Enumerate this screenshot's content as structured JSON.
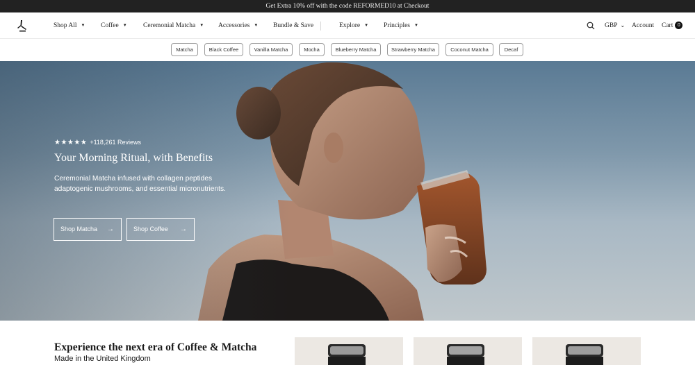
{
  "announcement": "Get Extra 10% off with the code REFORMED10 at Checkout",
  "nav": {
    "items": [
      {
        "label": "Shop All",
        "caret": true
      },
      {
        "label": "Coffee",
        "caret": true
      },
      {
        "label": "Ceremonial Matcha",
        "caret": true
      },
      {
        "label": "Accessories",
        "caret": true
      },
      {
        "label": "Bundle & Save",
        "caret": false
      },
      {
        "label": "Explore",
        "caret": true
      },
      {
        "label": "Principles",
        "caret": true
      }
    ],
    "currency": "GBP",
    "account": "Account",
    "cart": "Cart",
    "cart_count": "0",
    "icons": {
      "logo": "brand-logo",
      "search": "search-icon",
      "caret": "chevron-down-icon"
    }
  },
  "chips": [
    "Matcha",
    "Black Coffee",
    "Vanilla Matcha",
    "Mocha",
    "Blueberry Matcha",
    "Strawberry Matcha",
    "Coconut Matcha",
    "Decaf"
  ],
  "hero": {
    "stars": "★★★★★",
    "rating_count": 5,
    "reviews": "+118,261 Reviews",
    "title": "Your Morning Ritual, with Benefits",
    "body": "Ceremonial Matcha infused with collagen peptides adaptogenic mushrooms, and essential micronutrients.",
    "buttons": [
      {
        "label": "Shop Matcha",
        "icon": "arrow-right-icon"
      },
      {
        "label": "Shop Coffee",
        "icon": "arrow-right-icon"
      }
    ]
  },
  "section": {
    "title": "Experience the next era of Coffee & Matcha",
    "subtitle": "Made in the United Kingdom"
  },
  "colors": {
    "announcement_bg": "#222222",
    "card_bg": "#ece8e3",
    "sky": "#7f98ab"
  }
}
